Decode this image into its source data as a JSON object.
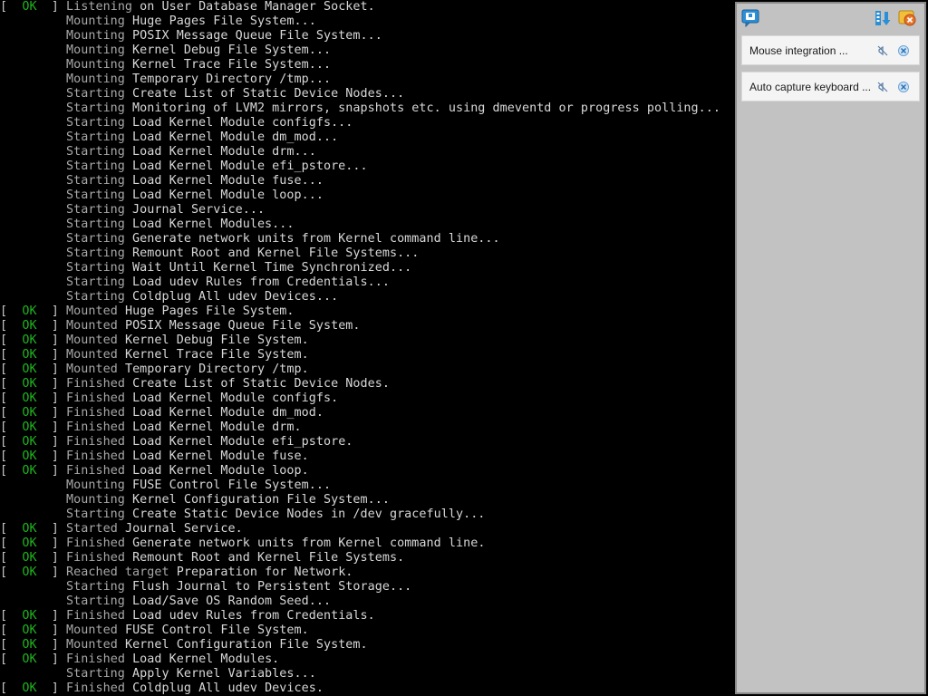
{
  "colors": {
    "console_bg": "#000000",
    "console_text": "#c8c8c8",
    "ok_status": "#1eb41e",
    "panel_bg": "#c2c2c2",
    "notification_bg": "#f4f4f4",
    "accent_blue": "#2b8fd6",
    "accent_orange": "#e8732a"
  },
  "console": {
    "lines": [
      {
        "status": "OK",
        "verb": "Listening",
        "msg": "on User Database Manager Socket."
      },
      {
        "status": "",
        "verb": "Mounting",
        "msg": "Huge Pages File System..."
      },
      {
        "status": "",
        "verb": "Mounting",
        "msg": "POSIX Message Queue File System..."
      },
      {
        "status": "",
        "verb": "Mounting",
        "msg": "Kernel Debug File System..."
      },
      {
        "status": "",
        "verb": "Mounting",
        "msg": "Kernel Trace File System..."
      },
      {
        "status": "",
        "verb": "Mounting",
        "msg": "Temporary Directory /tmp..."
      },
      {
        "status": "",
        "verb": "Starting",
        "msg": "Create List of Static Device Nodes..."
      },
      {
        "status": "",
        "verb": "Starting",
        "msg": "Monitoring of LVM2 mirrors, snapshots etc. using dmeventd or progress polling..."
      },
      {
        "status": "",
        "verb": "Starting",
        "msg": "Load Kernel Module configfs..."
      },
      {
        "status": "",
        "verb": "Starting",
        "msg": "Load Kernel Module dm_mod..."
      },
      {
        "status": "",
        "verb": "Starting",
        "msg": "Load Kernel Module drm..."
      },
      {
        "status": "",
        "verb": "Starting",
        "msg": "Load Kernel Module efi_pstore..."
      },
      {
        "status": "",
        "verb": "Starting",
        "msg": "Load Kernel Module fuse..."
      },
      {
        "status": "",
        "verb": "Starting",
        "msg": "Load Kernel Module loop..."
      },
      {
        "status": "",
        "verb": "Starting",
        "msg": "Journal Service..."
      },
      {
        "status": "",
        "verb": "Starting",
        "msg": "Load Kernel Modules..."
      },
      {
        "status": "",
        "verb": "Starting",
        "msg": "Generate network units from Kernel command line..."
      },
      {
        "status": "",
        "verb": "Starting",
        "msg": "Remount Root and Kernel File Systems..."
      },
      {
        "status": "",
        "verb": "Starting",
        "msg": "Wait Until Kernel Time Synchronized..."
      },
      {
        "status": "",
        "verb": "Starting",
        "msg": "Load udev Rules from Credentials..."
      },
      {
        "status": "",
        "verb": "Starting",
        "msg": "Coldplug All udev Devices..."
      },
      {
        "status": "OK",
        "verb": "Mounted",
        "msg": "Huge Pages File System."
      },
      {
        "status": "OK",
        "verb": "Mounted",
        "msg": "POSIX Message Queue File System."
      },
      {
        "status": "OK",
        "verb": "Mounted",
        "msg": "Kernel Debug File System."
      },
      {
        "status": "OK",
        "verb": "Mounted",
        "msg": "Kernel Trace File System."
      },
      {
        "status": "OK",
        "verb": "Mounted",
        "msg": "Temporary Directory /tmp."
      },
      {
        "status": "OK",
        "verb": "Finished",
        "msg": "Create List of Static Device Nodes."
      },
      {
        "status": "OK",
        "verb": "Finished",
        "msg": "Load Kernel Module configfs."
      },
      {
        "status": "OK",
        "verb": "Finished",
        "msg": "Load Kernel Module dm_mod."
      },
      {
        "status": "OK",
        "verb": "Finished",
        "msg": "Load Kernel Module drm."
      },
      {
        "status": "OK",
        "verb": "Finished",
        "msg": "Load Kernel Module efi_pstore."
      },
      {
        "status": "OK",
        "verb": "Finished",
        "msg": "Load Kernel Module fuse."
      },
      {
        "status": "OK",
        "verb": "Finished",
        "msg": "Load Kernel Module loop."
      },
      {
        "status": "",
        "verb": "Mounting",
        "msg": "FUSE Control File System..."
      },
      {
        "status": "",
        "verb": "Mounting",
        "msg": "Kernel Configuration File System..."
      },
      {
        "status": "",
        "verb": "Starting",
        "msg": "Create Static Device Nodes in /dev gracefully..."
      },
      {
        "status": "OK",
        "verb": "Started",
        "msg": "Journal Service."
      },
      {
        "status": "OK",
        "verb": "Finished",
        "msg": "Generate network units from Kernel command line."
      },
      {
        "status": "OK",
        "verb": "Finished",
        "msg": "Remount Root and Kernel File Systems."
      },
      {
        "status": "OK",
        "verb": "Reached target",
        "msg": "Preparation for Network."
      },
      {
        "status": "",
        "verb": "Starting",
        "msg": "Flush Journal to Persistent Storage..."
      },
      {
        "status": "",
        "verb": "Starting",
        "msg": "Load/Save OS Random Seed..."
      },
      {
        "status": "OK",
        "verb": "Finished",
        "msg": "Load udev Rules from Credentials."
      },
      {
        "status": "OK",
        "verb": "Mounted",
        "msg": "FUSE Control File System."
      },
      {
        "status": "OK",
        "verb": "Mounted",
        "msg": "Kernel Configuration File System."
      },
      {
        "status": "OK",
        "verb": "Finished",
        "msg": "Load Kernel Modules."
      },
      {
        "status": "",
        "verb": "Starting",
        "msg": "Apply Kernel Variables..."
      },
      {
        "status": "OK",
        "verb": "Finished",
        "msg": "Coldplug All udev Devices."
      }
    ]
  },
  "panel": {
    "header_icons": {
      "left": "notification-bubble-icon",
      "sort": "sort-icon",
      "close_all": "close-all-icon"
    },
    "notifications": [
      {
        "text": "Mouse integration ...",
        "mute_icon": "mute-icon",
        "close_icon": "close-icon"
      },
      {
        "text": "Auto capture keyboard ...",
        "mute_icon": "mute-icon",
        "close_icon": "close-icon"
      }
    ]
  }
}
